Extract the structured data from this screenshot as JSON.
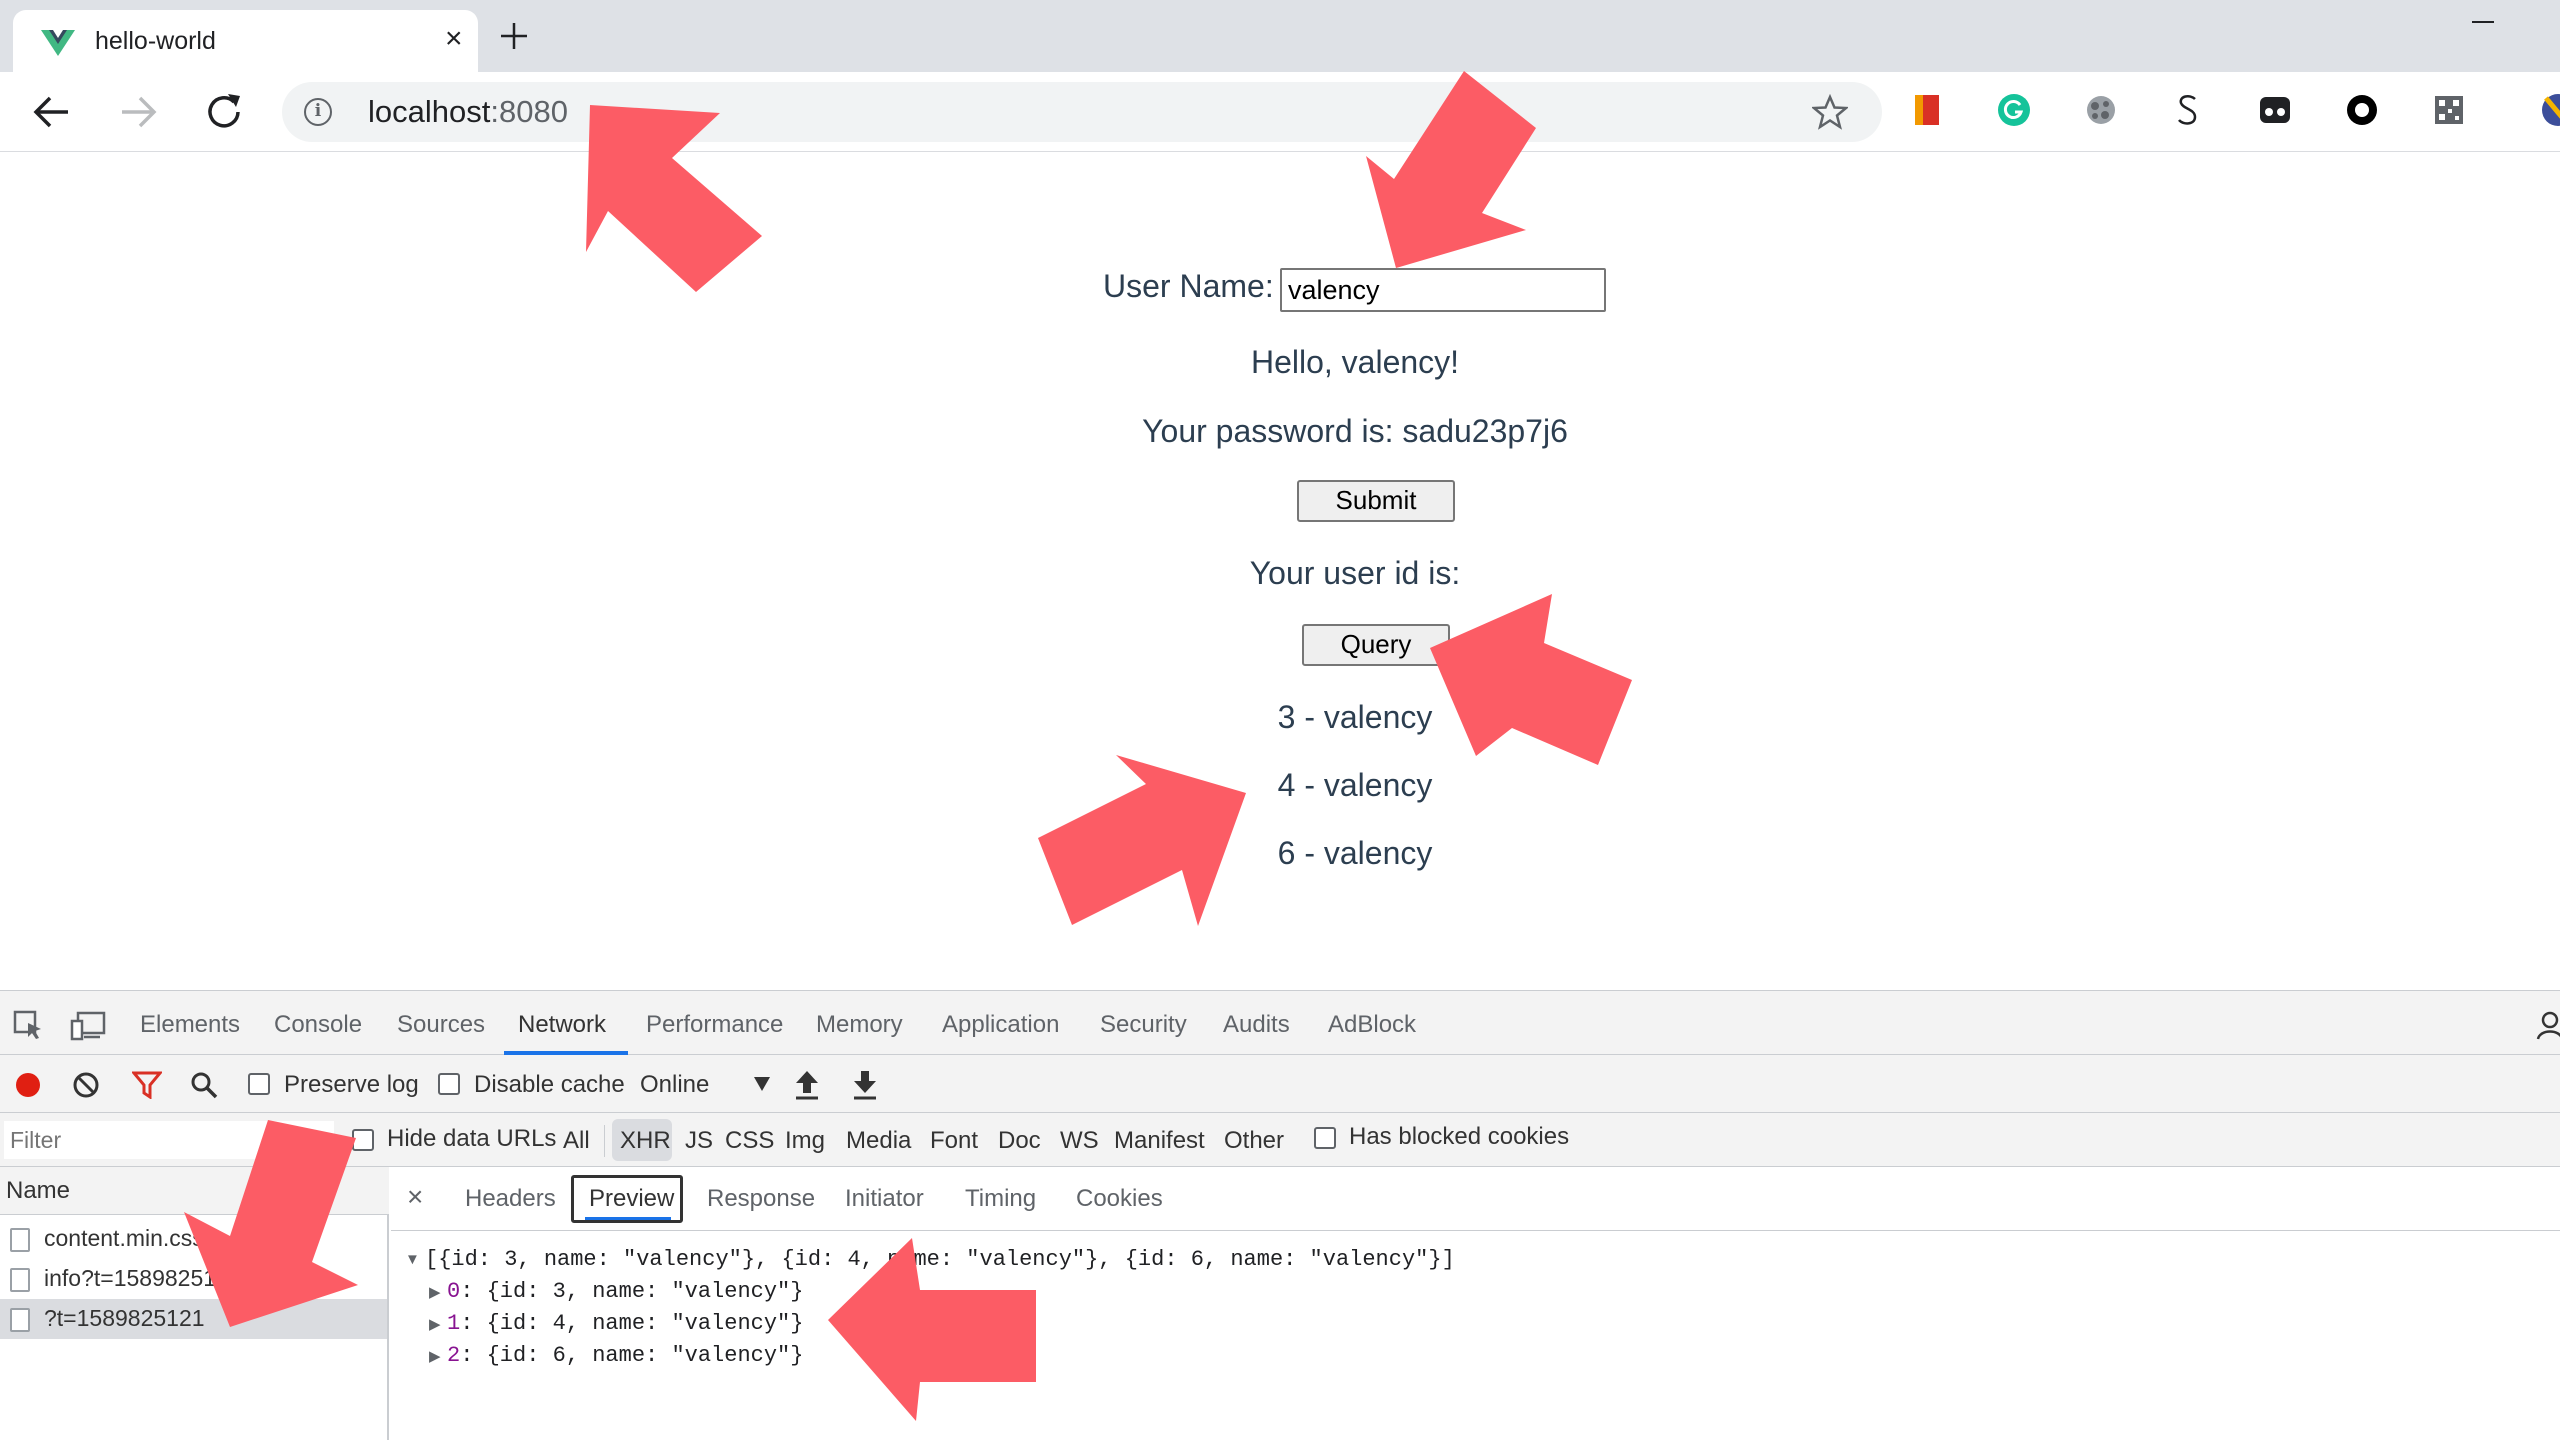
{
  "browser": {
    "tab_title": "hello-world",
    "close_glyph": "×",
    "url_host": "localhost",
    "url_port": ":8080",
    "info_glyph": "i",
    "extensions": [
      "bookmark-extension-icon",
      "grammarly-icon",
      "extension-icon",
      "s-extension-icon",
      "tab-extension-icon",
      "circle-extension-icon",
      "qr-extension-icon"
    ]
  },
  "page": {
    "username_label": "User Name:",
    "username_value": "valency",
    "greeting": "Hello, valency!",
    "password_line": "Your password is: sadu23p7j6",
    "submit_label": "Submit",
    "userid_line": "Your user id is:",
    "query_label": "Query",
    "results": [
      "3 - valency",
      "4 - valency",
      "6 - valency"
    ]
  },
  "devtools": {
    "tabs": [
      "Elements",
      "Console",
      "Sources",
      "Network",
      "Performance",
      "Memory",
      "Application",
      "Security",
      "Audits",
      "AdBlock"
    ],
    "active_tab": "Network",
    "toolbar": {
      "preserve_log": "Preserve log",
      "disable_cache": "Disable cache",
      "throttling": "Online"
    },
    "filter_placeholder": "Filter",
    "filter_bar": {
      "hide_data_urls": "Hide data URLs",
      "types": [
        "All",
        "XHR",
        "JS",
        "CSS",
        "Img",
        "Media",
        "Font",
        "Doc",
        "WS",
        "Manifest",
        "Other"
      ],
      "active_type": "XHR",
      "has_blocked_cookies": "Has blocked cookies"
    },
    "name_header": "Name",
    "requests": [
      "content.min.css",
      "info?t=1589825121",
      "?t=1589825121"
    ],
    "close_glyph": "×",
    "detail_tabs": [
      "Headers",
      "Preview",
      "Response",
      "Initiator",
      "Timing",
      "Cookies"
    ],
    "active_detail_tab": "Preview",
    "preview": {
      "summary": "[{id: 3, name: \"valency\"}, {id: 4, name: \"valency\"}, {id: 6, name: \"valency\"}]",
      "items": [
        {
          "index": "0",
          "text": ": {id: 3, name: \"valency\"}"
        },
        {
          "index": "1",
          "text": ": {id: 4, name: \"valency\"}"
        },
        {
          "index": "2",
          "text": ": {id: 6, name: \"valency\"}"
        }
      ]
    }
  },
  "colors": {
    "annotation_arrow": "#fc5c65",
    "page_text": "#2c3e50",
    "devtools_accent": "#1a73e8",
    "vue_green": "#41b883",
    "vue_dark": "#35495e"
  }
}
